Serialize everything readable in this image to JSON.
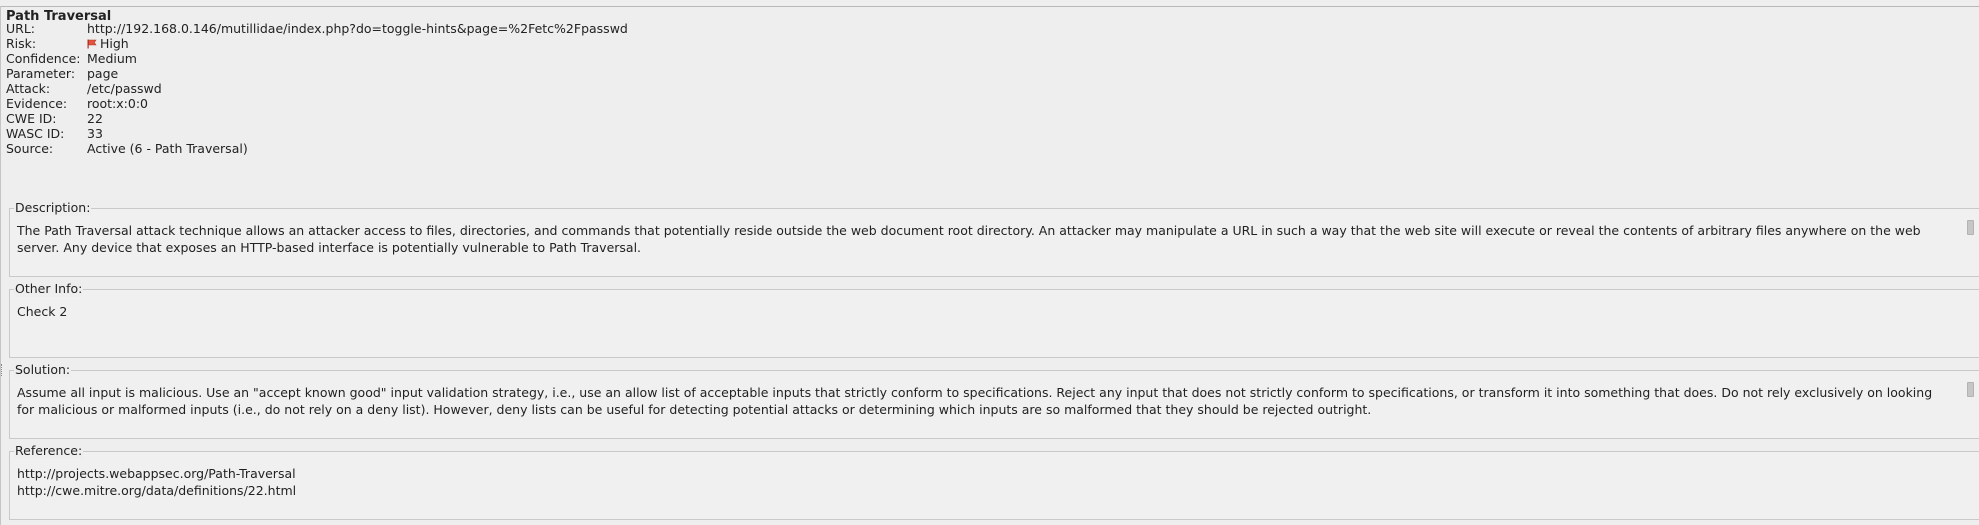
{
  "alert": {
    "title": "Path Traversal",
    "fields": [
      {
        "label": "URL:",
        "value": "http://192.168.0.146/mutillidae/index.php?do=toggle-hints&page=%2Fetc%2Fpasswd"
      },
      {
        "label": "Risk:",
        "value": "High",
        "icon": "high-risk-flag-icon"
      },
      {
        "label": "Confidence:",
        "value": "Medium"
      },
      {
        "label": "Parameter:",
        "value": "page"
      },
      {
        "label": "Attack:",
        "value": "/etc/passwd"
      },
      {
        "label": "Evidence:",
        "value": "root:x:0:0"
      },
      {
        "label": "CWE ID:",
        "value": "22"
      },
      {
        "label": "WASC ID:",
        "value": "33"
      },
      {
        "label": "Source:",
        "value": "Active (6 - Path Traversal)"
      }
    ],
    "description": {
      "label": "Description:",
      "text": "The Path Traversal attack technique allows an attacker access to files, directories, and commands that potentially reside outside the web document root directory. An attacker may manipulate a URL in such a way that the web site will execute or reveal the contents of arbitrary files anywhere on the web\nserver. Any device that exposes an HTTP-based interface is potentially vulnerable to Path Traversal."
    },
    "other_info": {
      "label": "Other Info:",
      "text": "Check 2"
    },
    "solution": {
      "label": "Solution:",
      "text": "Assume all input is malicious. Use an \"accept known good\" input validation strategy, i.e., use an allow list of acceptable inputs that strictly conform to specifications. Reject any input that does not strictly conform to specifications, or transform it into something that does. Do not rely exclusively on looking\nfor malicious or malformed inputs (i.e., do not rely on a deny list). However, deny lists can be useful for detecting potential attacks or determining which inputs are so malformed that they should be rejected outright."
    },
    "reference": {
      "label": "Reference:",
      "text": "http://projects.webappsec.org/Path-Traversal\nhttp://cwe.mitre.org/data/definitions/22.html"
    },
    "colors": {
      "risk_high": "#e5533d"
    }
  }
}
